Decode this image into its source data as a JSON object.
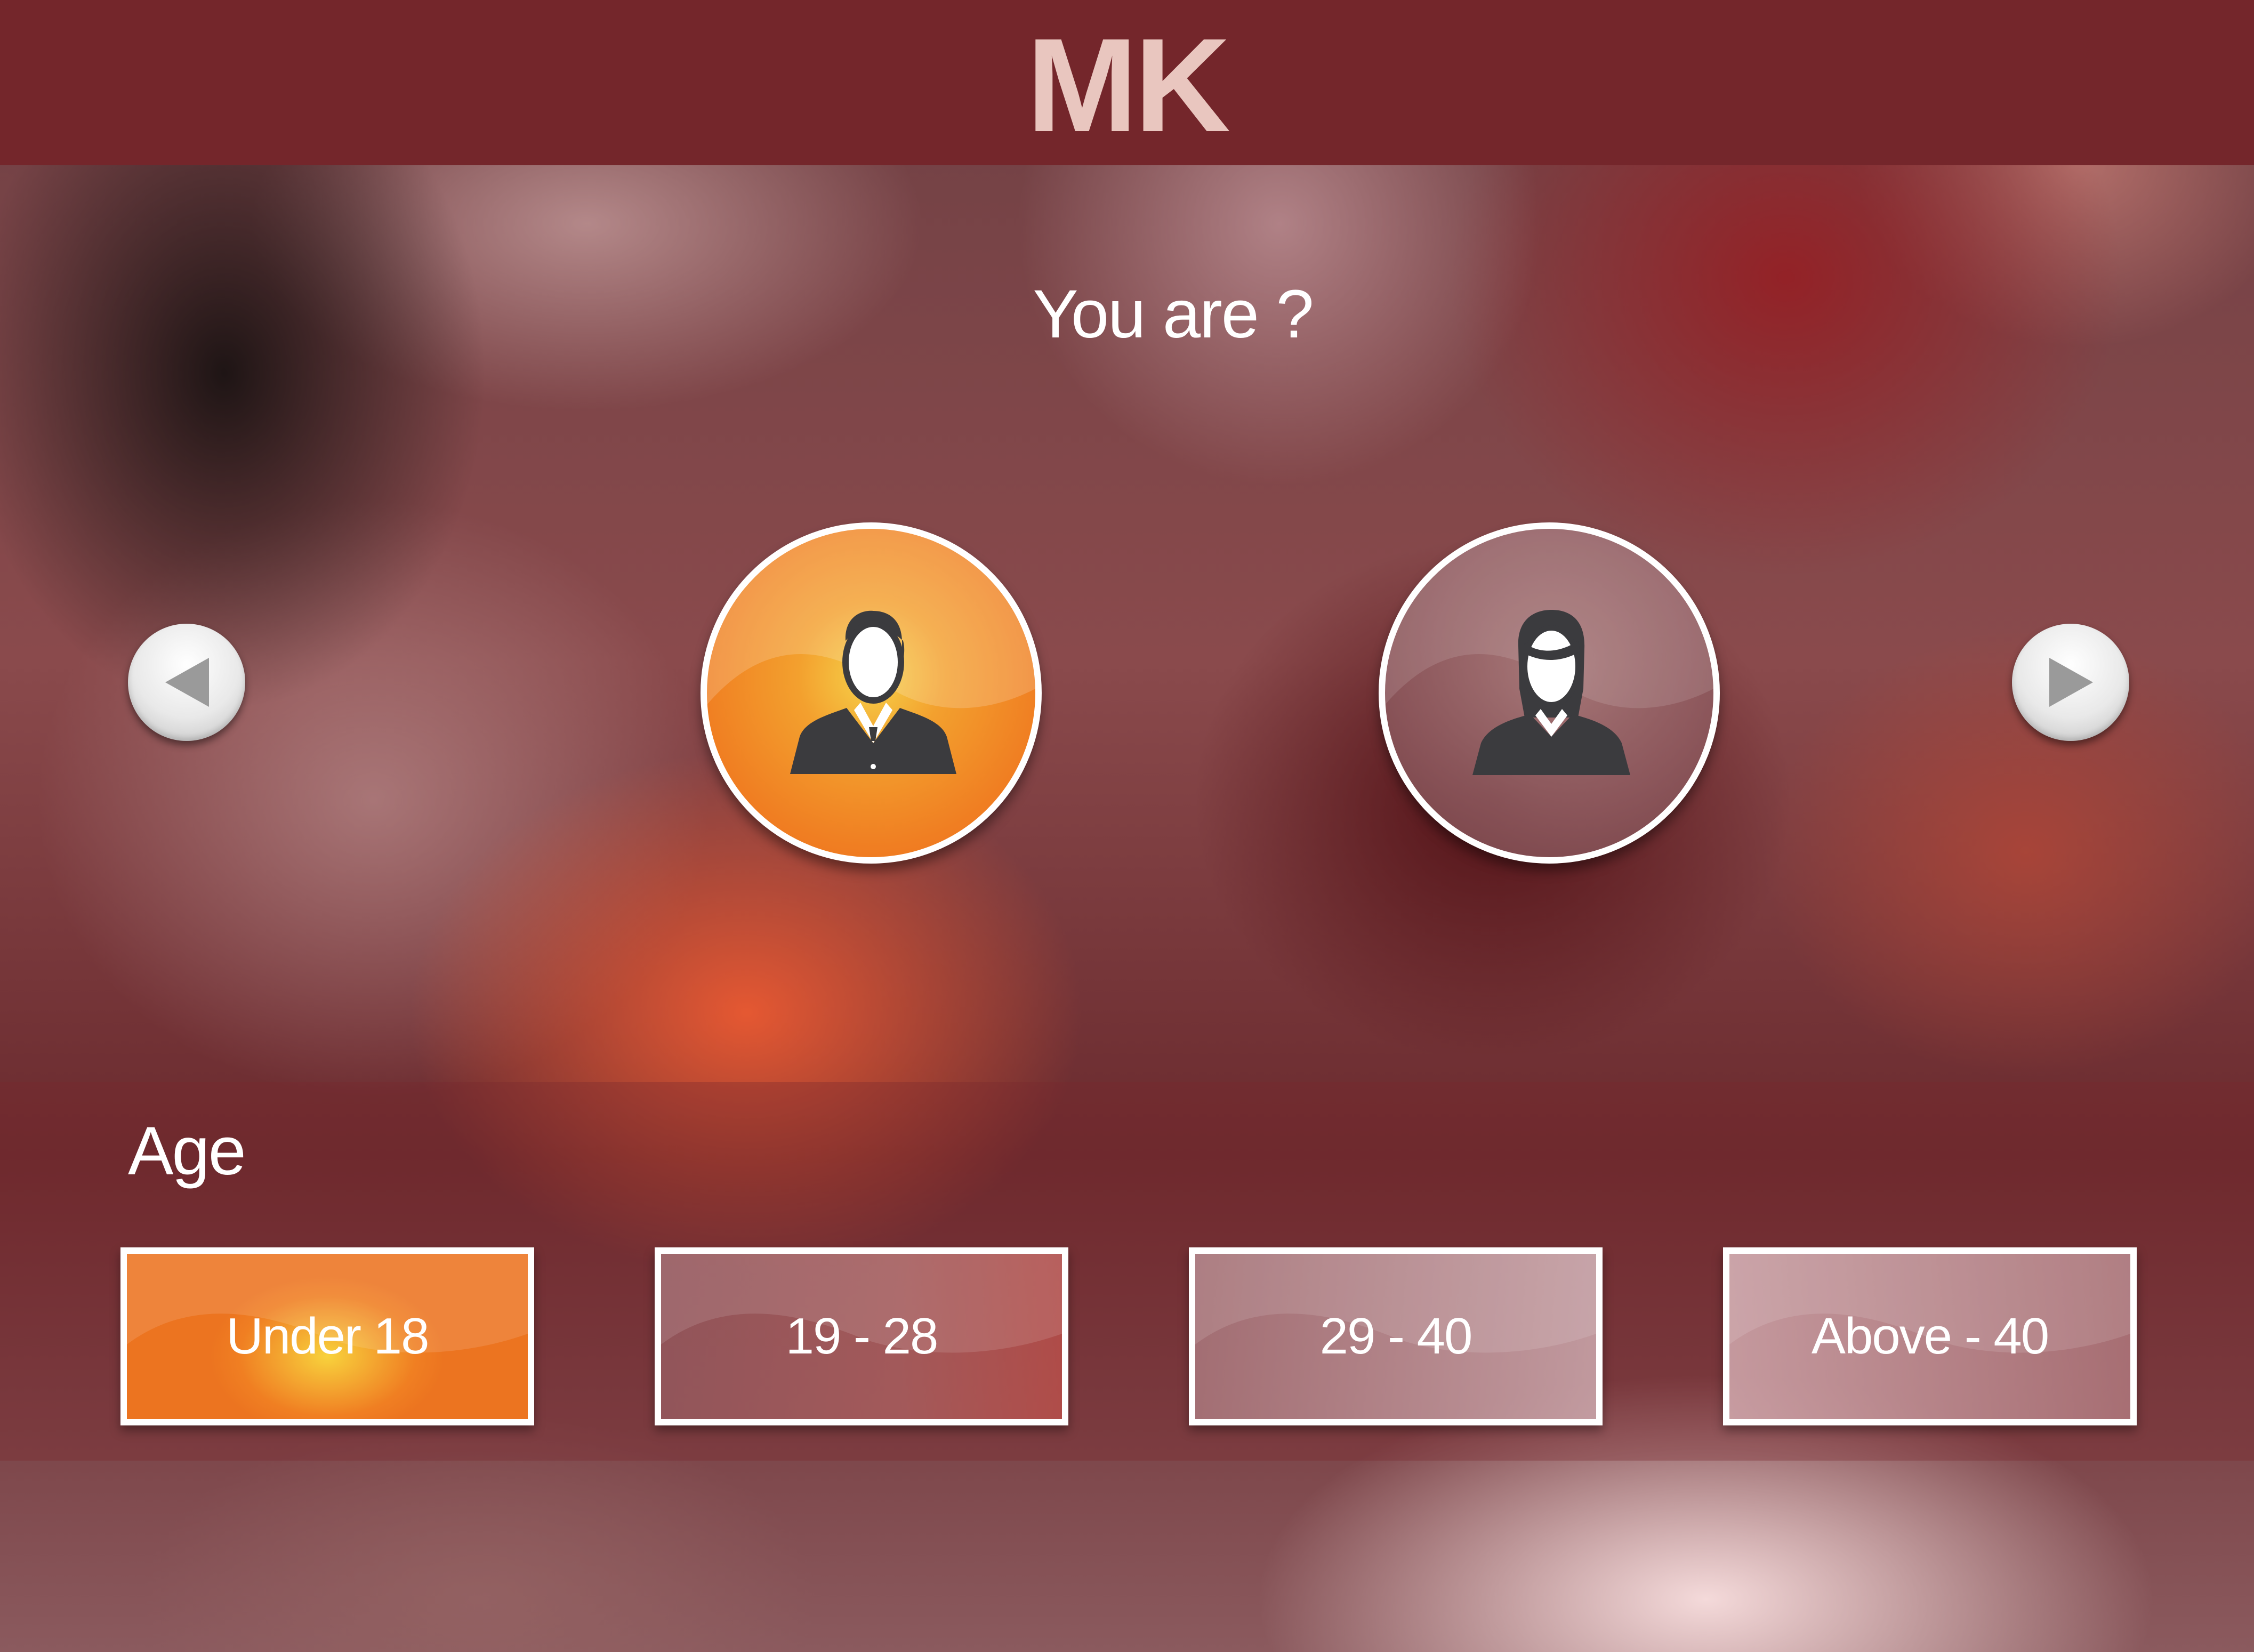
{
  "header": {
    "title": "MK"
  },
  "gender": {
    "question": "You are ?",
    "options": [
      {
        "id": "male",
        "icon": "male-user-icon",
        "selected": true
      },
      {
        "id": "female",
        "icon": "female-user-icon",
        "selected": false
      }
    ],
    "prev_icon": "chevron-left-icon",
    "next_icon": "chevron-right-icon"
  },
  "age": {
    "label": "Age",
    "options": [
      {
        "label": "Under 18",
        "selected": true
      },
      {
        "label": "19 - 28",
        "selected": false
      },
      {
        "label": "29 - 40",
        "selected": false
      },
      {
        "label": "Above - 40",
        "selected": false
      }
    ]
  },
  "colors": {
    "header_bar": "#74262b",
    "header_text": "#e9c6bf",
    "accent_orange": "#f07e22",
    "highlight_yellow": "#f6d24a",
    "border_white": "#ffffff",
    "icon_dark": "#3b3b3e"
  }
}
